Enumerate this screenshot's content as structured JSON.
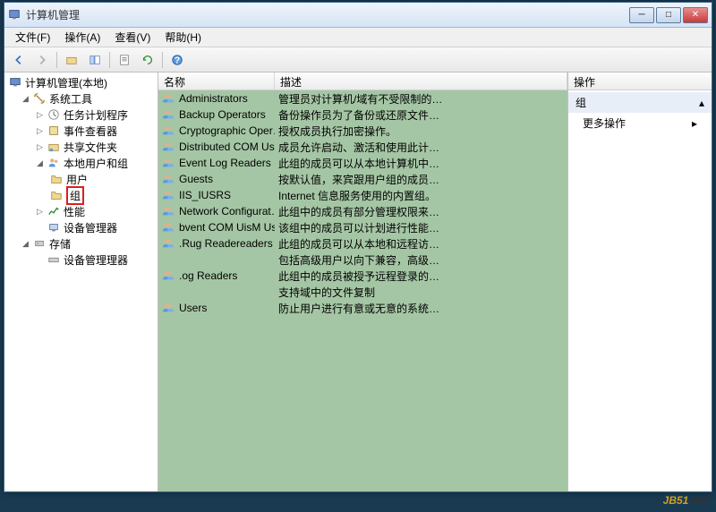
{
  "window": {
    "title": "计算机管理"
  },
  "menu": {
    "file": "文件(F)",
    "action": "操作(A)",
    "view": "查看(V)",
    "help": "帮助(H)"
  },
  "tree": {
    "root": "计算机管理(本地)",
    "system_tools": "系统工具",
    "task_scheduler": "任务计划程序",
    "event_viewer": "事件查看器",
    "shared_folders": "共享文件夹",
    "local_users_groups": "本地用户和组",
    "users": "用户",
    "groups": "组",
    "performance": "性能",
    "device_manager": "设备管理器",
    "storage": "存储",
    "disk_management": "设备管理理器"
  },
  "list": {
    "col_name": "名称",
    "col_desc": "描述",
    "rows": [
      {
        "name": "Administrators",
        "desc": "管理员对计算机/域有不受限制的…"
      },
      {
        "name": "Backup Operators",
        "desc": "备份操作员为了备份或还原文件…"
      },
      {
        "name": "Cryptographic Oper…",
        "desc": "授权成员执行加密操作。"
      },
      {
        "name": "Distributed COM Us…",
        "desc": "成员允许启动、激活和使用此计…"
      },
      {
        "name": "Event Log Readers",
        "desc": "此组的成员可以从本地计算机中…"
      },
      {
        "name": "Guests",
        "desc": "按默认值，来宾跟用户组的成员…"
      },
      {
        "name": "IIS_IUSRS",
        "desc": "Internet 信息服务使用的内置组。"
      },
      {
        "name": "Network Configurat…",
        "desc": "此组中的成员有部分管理权限来…"
      },
      {
        "name": "bvent COM UisM Us…",
        "desc": "该组中的成员可以计划进行性能…"
      },
      {
        "name": ".Rug Readereaders",
        "desc": "此组的成员可以从本地和远程访…"
      },
      {
        "name": "",
        "desc": "包括高级用户以向下兼容，高级…"
      },
      {
        "name": ".og Readers",
        "desc": "此组中的成员被授予远程登录的…"
      },
      {
        "name": "",
        "desc": "支持域中的文件复制"
      },
      {
        "name": "Users",
        "desc": "防止用户进行有意或无意的系统…"
      }
    ]
  },
  "actions": {
    "header": "操作",
    "section": "组",
    "more": "更多操作"
  },
  "watermark": {
    "jb": "JB51",
    "net": ".Net"
  }
}
